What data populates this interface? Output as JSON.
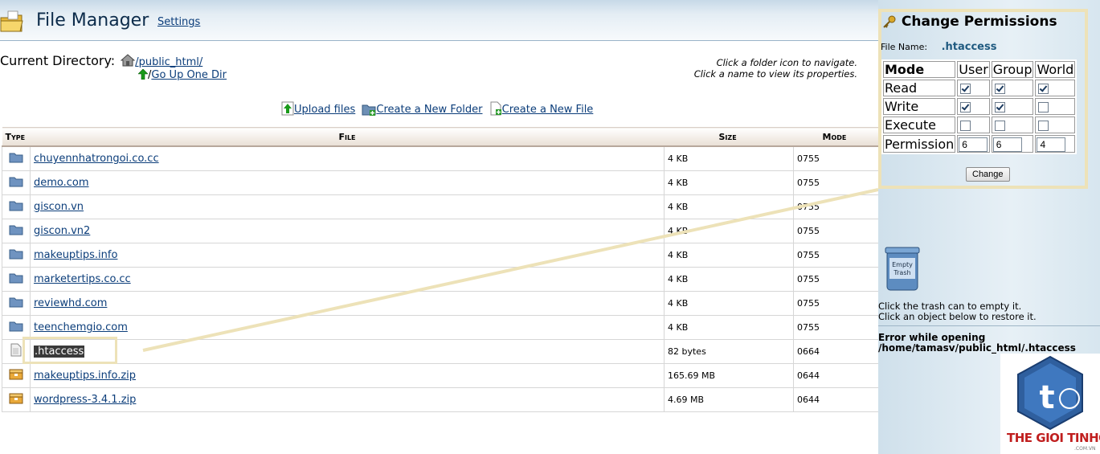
{
  "header": {
    "title": "File Manager",
    "settings_link": "Settings"
  },
  "current_directory": {
    "label": "Current Directory:",
    "path": "/public_html/",
    "up_sep": "/",
    "up_link": "Go Up One Dir"
  },
  "hints": {
    "line1": "Click a folder icon to navigate.",
    "line2": "Click a name to view its properties."
  },
  "actions": {
    "upload": "Upload files",
    "new_folder": "Create a New Folder",
    "new_file": "Create a New File"
  },
  "table": {
    "headers": {
      "type": "Type",
      "file": "File",
      "size": "Size",
      "mode": "Mode"
    },
    "rows": [
      {
        "icon": "folder-icon",
        "name": "chuyennhatrongoi.co.cc",
        "size": "4 KB",
        "mode": "0755"
      },
      {
        "icon": "folder-icon",
        "name": "demo.com",
        "size": "4 KB",
        "mode": "0755"
      },
      {
        "icon": "folder-icon",
        "name": "giscon.vn",
        "size": "4 KB",
        "mode": "0755"
      },
      {
        "icon": "folder-icon",
        "name": "giscon.vn2",
        "size": "4 KB",
        "mode": "0755"
      },
      {
        "icon": "folder-icon",
        "name": "makeuptips.info",
        "size": "4 KB",
        "mode": "0755"
      },
      {
        "icon": "folder-icon",
        "name": "marketertips.co.cc",
        "size": "4 KB",
        "mode": "0755"
      },
      {
        "icon": "folder-icon",
        "name": "reviewhd.com",
        "size": "4 KB",
        "mode": "0755"
      },
      {
        "icon": "folder-icon",
        "name": "teenchemgio.com",
        "size": "4 KB",
        "mode": "0755"
      },
      {
        "icon": "file-icon",
        "name": ".htaccess",
        "size": "82 bytes",
        "mode": "0664",
        "selected": true
      },
      {
        "icon": "archive-icon",
        "name": "makeuptips.info.zip",
        "size": "165.69 MB",
        "mode": "0644"
      },
      {
        "icon": "archive-icon",
        "name": "wordpress-3.4.1.zip",
        "size": "4.69 MB",
        "mode": "0644"
      }
    ]
  },
  "permissions": {
    "title": "Change Permissions",
    "file_name_label": "File Name:",
    "file_name": ".htaccess",
    "headers": {
      "mode": "Mode",
      "user": "User",
      "group": "Group",
      "world": "World"
    },
    "rows": [
      {
        "label": "Read",
        "user": true,
        "group": true,
        "world": true
      },
      {
        "label": "Write",
        "user": true,
        "group": true,
        "world": false
      },
      {
        "label": "Execute",
        "user": false,
        "group": false,
        "world": false
      }
    ],
    "permission_label": "Permission",
    "values": {
      "user": "6",
      "group": "6",
      "world": "4"
    },
    "button": "Change"
  },
  "trash": {
    "icon_label_1": "Empty",
    "icon_label_2": "Trash",
    "line1": "Click the trash can to empty it.",
    "line2": "Click an object below to restore it."
  },
  "error": {
    "line1": "Error while opening",
    "line2": "/home/tamasv/public_html/.htaccess"
  },
  "brand": {
    "text": "THE GIOI TINHOC",
    "sub": ".COM.VN",
    "color": "#c01f1f"
  }
}
